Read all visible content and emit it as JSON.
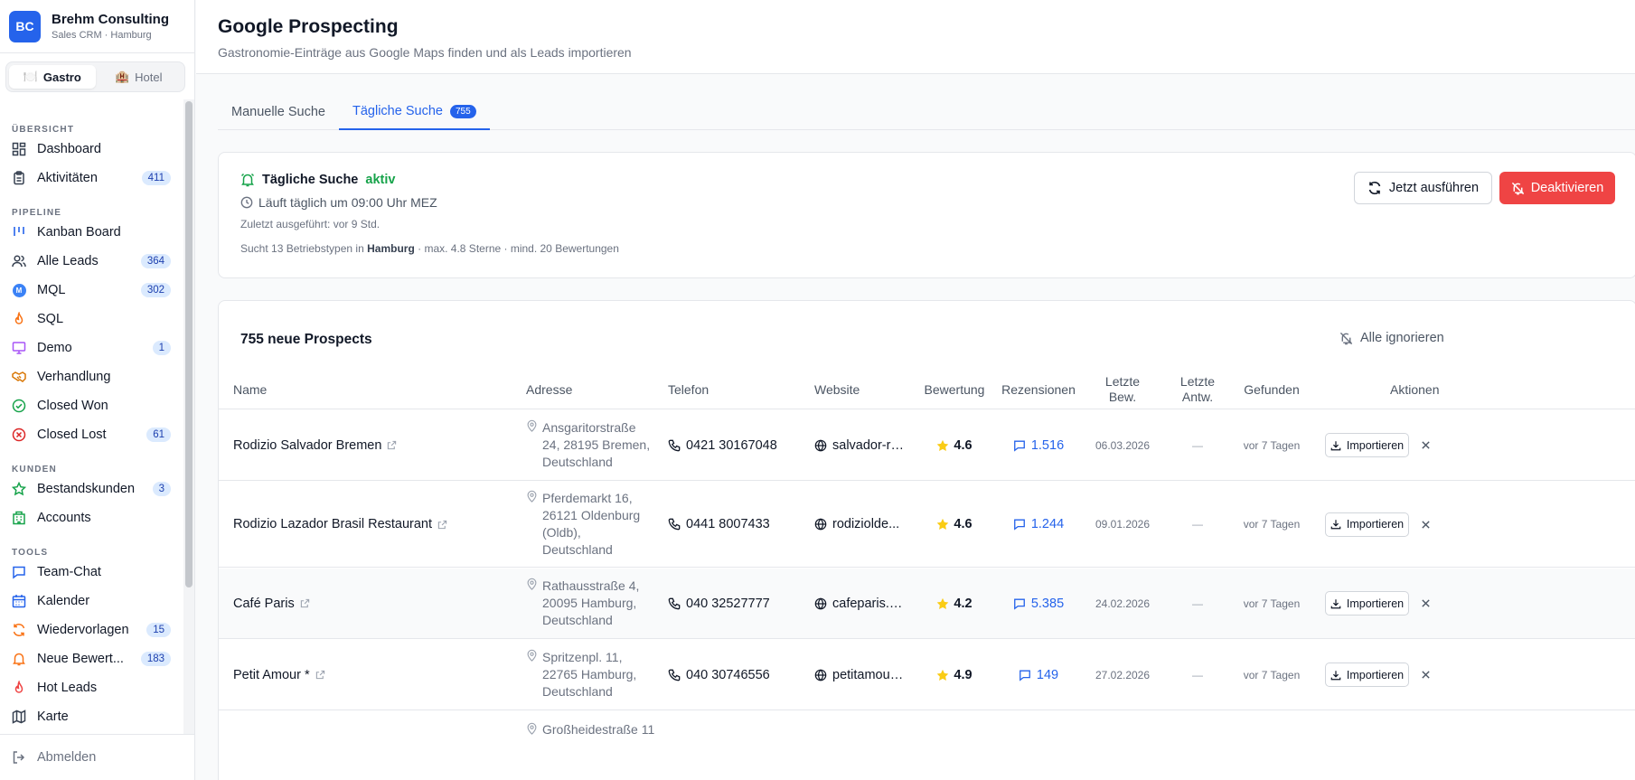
{
  "brand": {
    "initials": "BC",
    "name": "Brehm Consulting",
    "subtitle": "Sales CRM · Hamburg"
  },
  "segments": [
    {
      "icon": "🍽️",
      "label": "Gastro",
      "active": true
    },
    {
      "icon": "🏨",
      "label": "Hotel",
      "active": false
    }
  ],
  "nav": {
    "overview": {
      "title": "ÜBERSICHT",
      "dashboard": "Dashboard",
      "activities": "Aktivitäten",
      "activities_count": "411"
    },
    "pipeline": {
      "title": "PIPELINE",
      "kanban": "Kanban Board",
      "all_leads": "Alle Leads",
      "all_leads_count": "364",
      "mql": "MQL",
      "mql_count": "302",
      "mql_letter": "M",
      "sql": "SQL",
      "demo": "Demo",
      "demo_count": "1",
      "negotiation": "Verhandlung",
      "won": "Closed Won",
      "lost": "Closed Lost",
      "lost_count": "61"
    },
    "customers": {
      "title": "KUNDEN",
      "existing": "Bestandskunden",
      "existing_count": "3",
      "accounts": "Accounts"
    },
    "tools": {
      "title": "TOOLS",
      "chat": "Team-Chat",
      "calendar": "Kalender",
      "followups": "Wiedervorlagen",
      "followups_count": "15",
      "reviews": "Neue Bewert...",
      "reviews_count": "183",
      "hot": "Hot Leads",
      "map": "Karte"
    },
    "logout": "Abmelden"
  },
  "header": {
    "title": "Google Prospecting",
    "subtitle": "Gastronomie-Einträge aus Google Maps finden und als Leads importieren"
  },
  "tabs": {
    "manual": "Manuelle Suche",
    "daily": "Tägliche Suche",
    "daily_count": "755"
  },
  "daily": {
    "title": "Tägliche Suche",
    "status": "aktiv",
    "schedule": "Läuft täglich um 09:00 Uhr MEZ",
    "last_run": "Zuletzt ausgeführt: vor 9 Std.",
    "search_prefix": "Sucht 13 Betriebstypen in",
    "search_city": "Hamburg",
    "search_suffix": "· max. 4.8 Sterne · mind. 20 Bewertungen",
    "run_label": "Jetzt ausführen",
    "deactivate_label": "Deaktivieren"
  },
  "prospects": {
    "title": "755 neue Prospects",
    "ignore_all": "Alle ignorieren",
    "columns": {
      "name": "Name",
      "address": "Adresse",
      "phone": "Telefon",
      "website": "Website",
      "rating": "Bewertung",
      "reviews": "Rezensionen",
      "last_review_1": "Letzte",
      "last_review_2": "Bew.",
      "last_answer_1": "Letzte",
      "last_answer_2": "Antw.",
      "found": "Gefunden",
      "actions": "Aktionen"
    },
    "import_label": "Importieren",
    "rows": [
      {
        "name": "Rodizio Salvador Bremen",
        "address": [
          "Ansgaritorstraße",
          "24, 28195 Bremen,",
          "Deutschland"
        ],
        "phone": "0421 30167048",
        "website": "salvador-ro...",
        "rating": "4.6",
        "reviews": "1.516",
        "last_review": "06.03.2026",
        "last_answer": "—",
        "found": "vor 7 Tagen"
      },
      {
        "name": "Rodizio Lazador Brasil Restaurant",
        "address": [
          "Pferdemarkt 16,",
          "26121 Oldenburg",
          "(Oldb),",
          "Deutschland"
        ],
        "phone": "0441 8007433",
        "website": "rodiziolde...",
        "rating": "4.6",
        "reviews": "1.244",
        "last_review": "09.01.2026",
        "last_answer": "—",
        "found": "vor 7 Tagen"
      },
      {
        "name": "Café Paris",
        "address": [
          "Rathausstraße 4,",
          "20095 Hamburg,",
          "Deutschland"
        ],
        "phone": "040 32527777",
        "website": "cafeparis.net/",
        "rating": "4.2",
        "reviews": "5.385",
        "last_review": "24.02.2026",
        "last_answer": "—",
        "found": "vor 7 Tagen"
      },
      {
        "name": "Petit Amour *",
        "address": [
          "Spritzenpl. 11,",
          "22765 Hamburg,",
          "Deutschland"
        ],
        "phone": "040 30746556",
        "website": "petitamour-...",
        "rating": "4.9",
        "reviews": "149",
        "last_review": "27.02.2026",
        "last_answer": "—",
        "found": "vor 7 Tagen"
      }
    ],
    "partial_address": "Großheidestraße 11"
  },
  "colors": {
    "accent": "#2563eb",
    "danger": "#ef4444",
    "success": "#16a34a",
    "star": "#facc15"
  }
}
